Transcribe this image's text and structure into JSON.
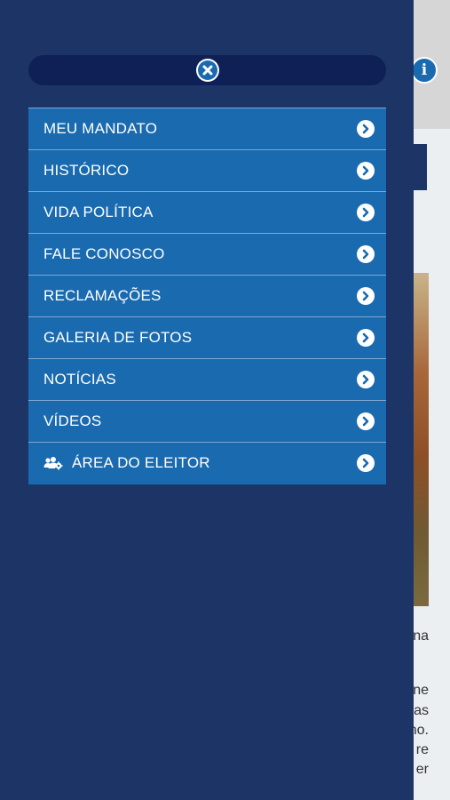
{
  "background": {
    "info_icon_glyph": "i",
    "text_lines": [
      "na",
      "ne",
      "as",
      "no.",
      "re",
      "er"
    ]
  },
  "drawer": {
    "close_icon": "close-icon",
    "menu": [
      {
        "label": "MEU MANDATO",
        "icon": null
      },
      {
        "label": "HISTÓRICO",
        "icon": null
      },
      {
        "label": "VIDA POLÍTICA",
        "icon": null
      },
      {
        "label": "FALE CONOSCO",
        "icon": null
      },
      {
        "label": "RECLAMAÇÕES",
        "icon": null
      },
      {
        "label": "GALERIA DE FOTOS",
        "icon": null
      },
      {
        "label": "NOTÍCIAS",
        "icon": null
      },
      {
        "label": "VÍDEOS",
        "icon": null
      },
      {
        "label": "ÁREA DO ELEITOR",
        "icon": "users-gear-icon"
      }
    ]
  },
  "colors": {
    "drawer_bg": "#1d3467",
    "close_bar_bg": "#0f2057",
    "menu_item_bg": "#1a6aaf",
    "menu_divider": "#7fa7d0",
    "text": "#ffffff"
  }
}
